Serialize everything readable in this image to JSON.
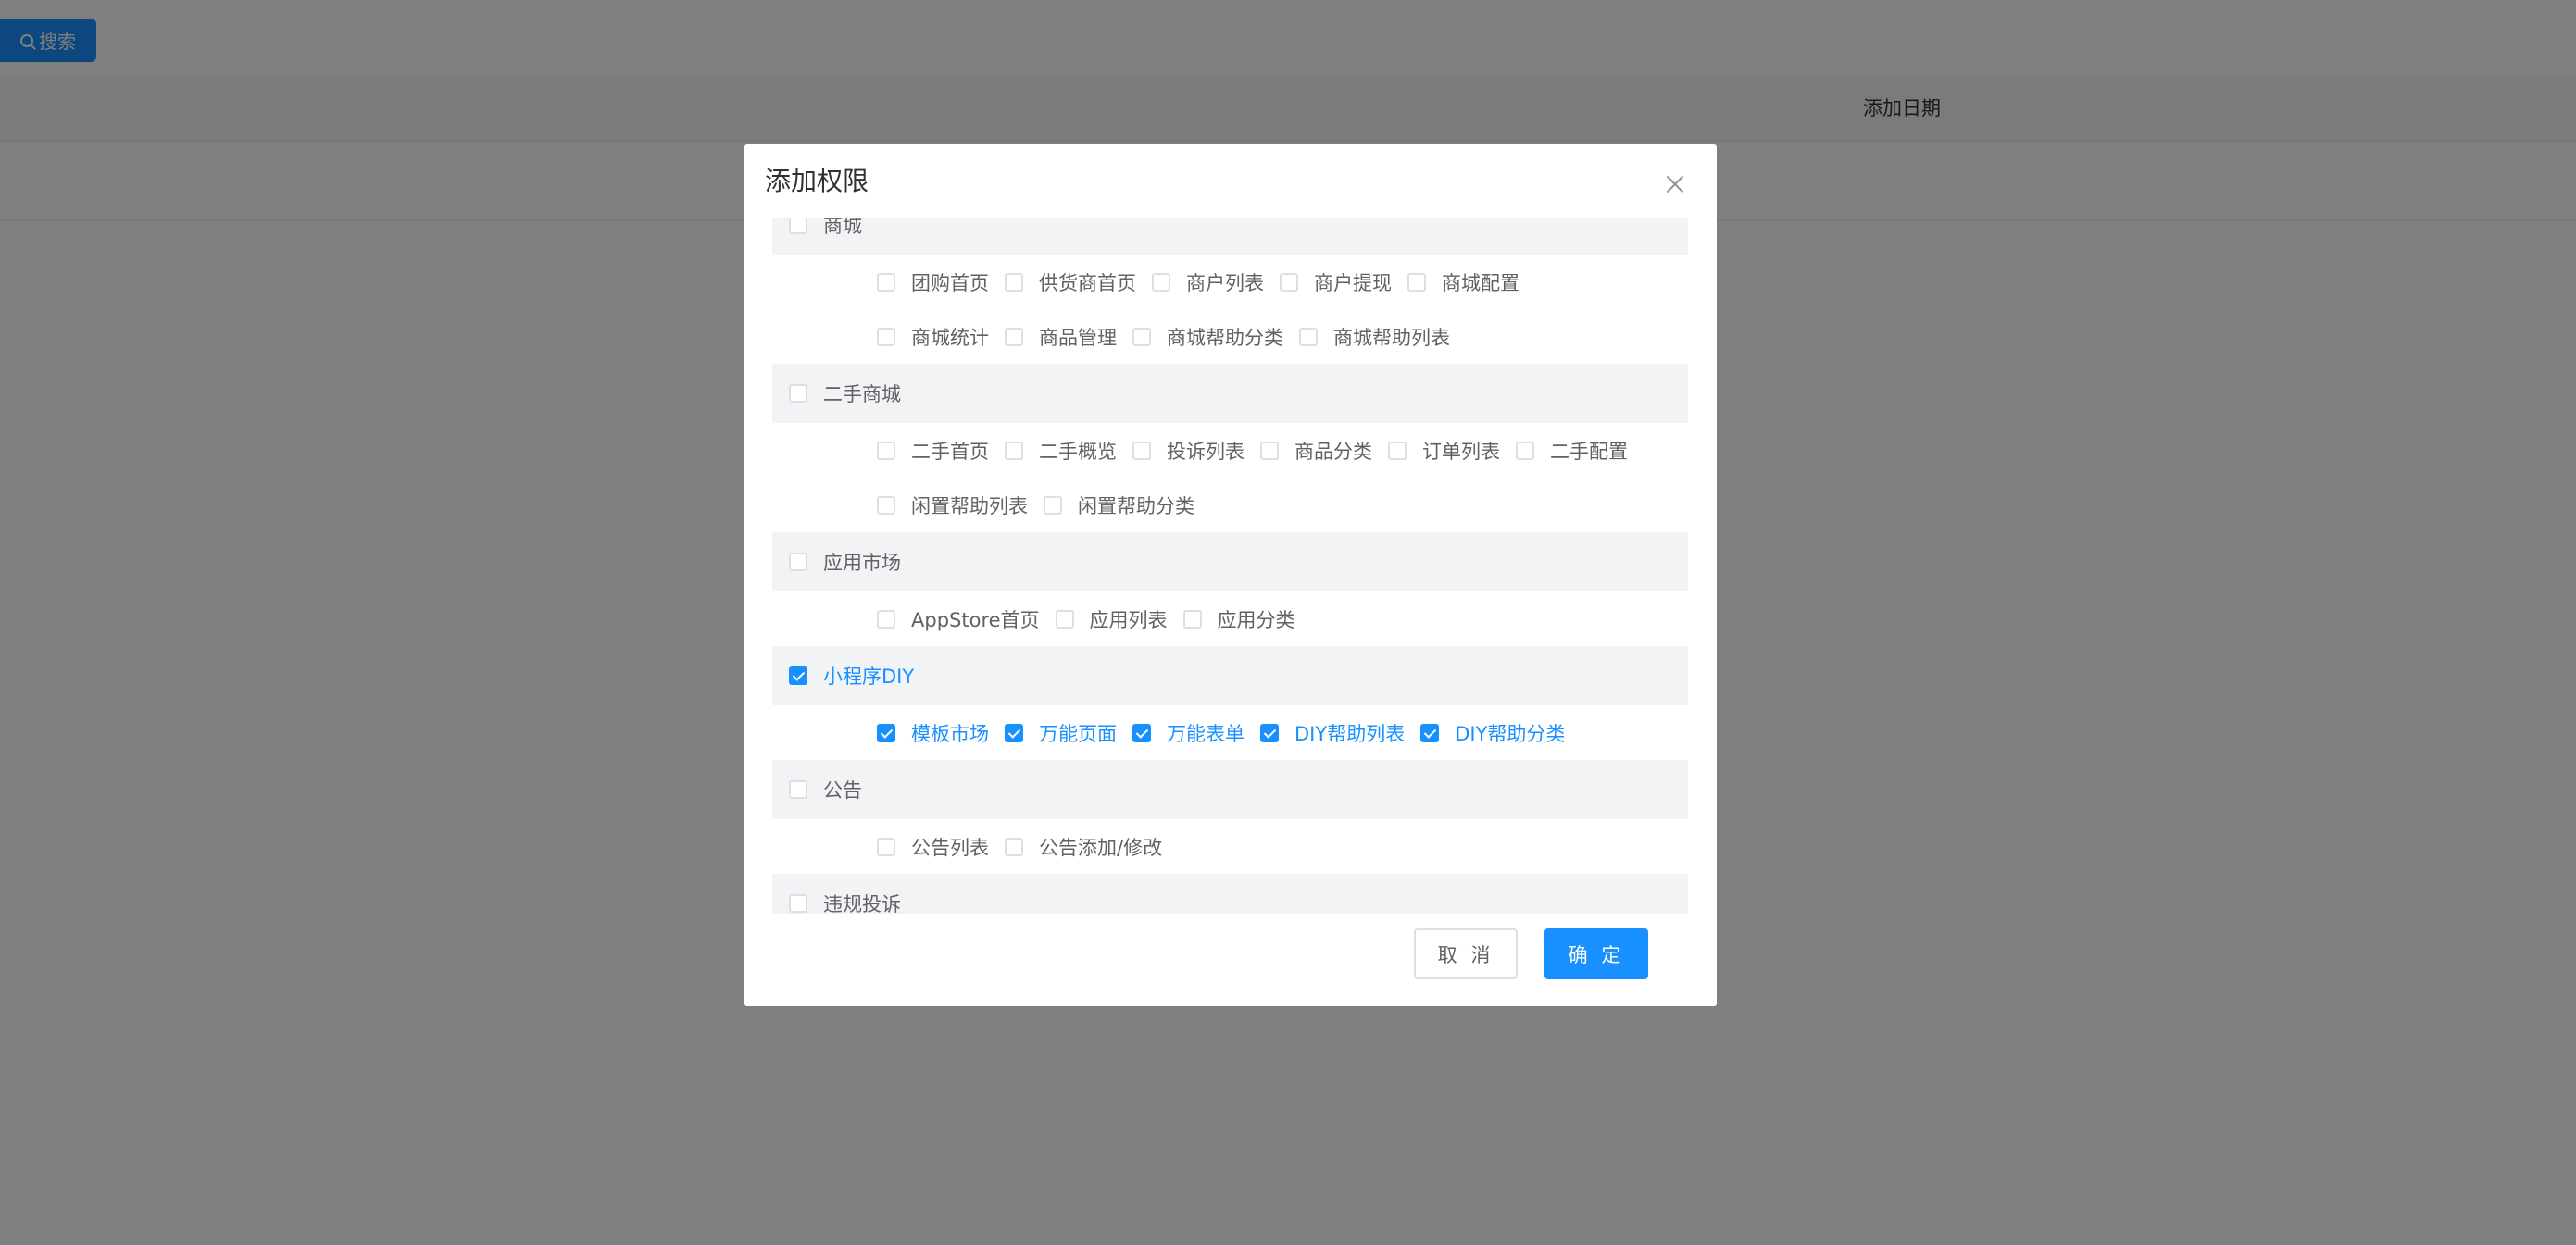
{
  "background": {
    "search_label": "搜索",
    "table_header_date": "添加日期"
  },
  "dialog": {
    "title": "添加权限",
    "cancel_label": "取 消",
    "ok_label": "确 定"
  },
  "groups": [
    {
      "label": "商城",
      "checked": false,
      "lines": [
        [
          {
            "label": "团购首页",
            "checked": false
          },
          {
            "label": "供货商首页",
            "checked": false
          },
          {
            "label": "商户列表",
            "checked": false
          },
          {
            "label": "商户提现",
            "checked": false
          },
          {
            "label": "商城配置",
            "checked": false
          }
        ],
        [
          {
            "label": "商城统计",
            "checked": false
          },
          {
            "label": "商品管理",
            "checked": false
          },
          {
            "label": "商城帮助分类",
            "checked": false
          },
          {
            "label": "商城帮助列表",
            "checked": false
          }
        ]
      ]
    },
    {
      "label": "二手商城",
      "checked": false,
      "lines": [
        [
          {
            "label": "二手首页",
            "checked": false
          },
          {
            "label": "二手概览",
            "checked": false
          },
          {
            "label": "投诉列表",
            "checked": false
          },
          {
            "label": "商品分类",
            "checked": false
          },
          {
            "label": "订单列表",
            "checked": false
          },
          {
            "label": "二手配置",
            "checked": false
          }
        ],
        [
          {
            "label": "闲置帮助列表",
            "checked": false
          },
          {
            "label": "闲置帮助分类",
            "checked": false
          }
        ]
      ]
    },
    {
      "label": "应用市场",
      "checked": false,
      "lines": [
        [
          {
            "label": "AppStore首页",
            "checked": false
          },
          {
            "label": "应用列表",
            "checked": false
          },
          {
            "label": "应用分类",
            "checked": false
          }
        ]
      ]
    },
    {
      "label": "小程序DIY",
      "checked": true,
      "lines": [
        [
          {
            "label": "模板市场",
            "checked": true
          },
          {
            "label": "万能页面",
            "checked": true
          },
          {
            "label": "万能表单",
            "checked": true
          },
          {
            "label": "DIY帮助列表",
            "checked": true
          },
          {
            "label": "DIY帮助分类",
            "checked": true
          }
        ]
      ]
    },
    {
      "label": "公告",
      "checked": false,
      "lines": [
        [
          {
            "label": "公告列表",
            "checked": false
          },
          {
            "label": "公告添加/修改",
            "checked": false
          }
        ]
      ]
    },
    {
      "label": "违规投诉",
      "checked": false,
      "lines": []
    }
  ]
}
